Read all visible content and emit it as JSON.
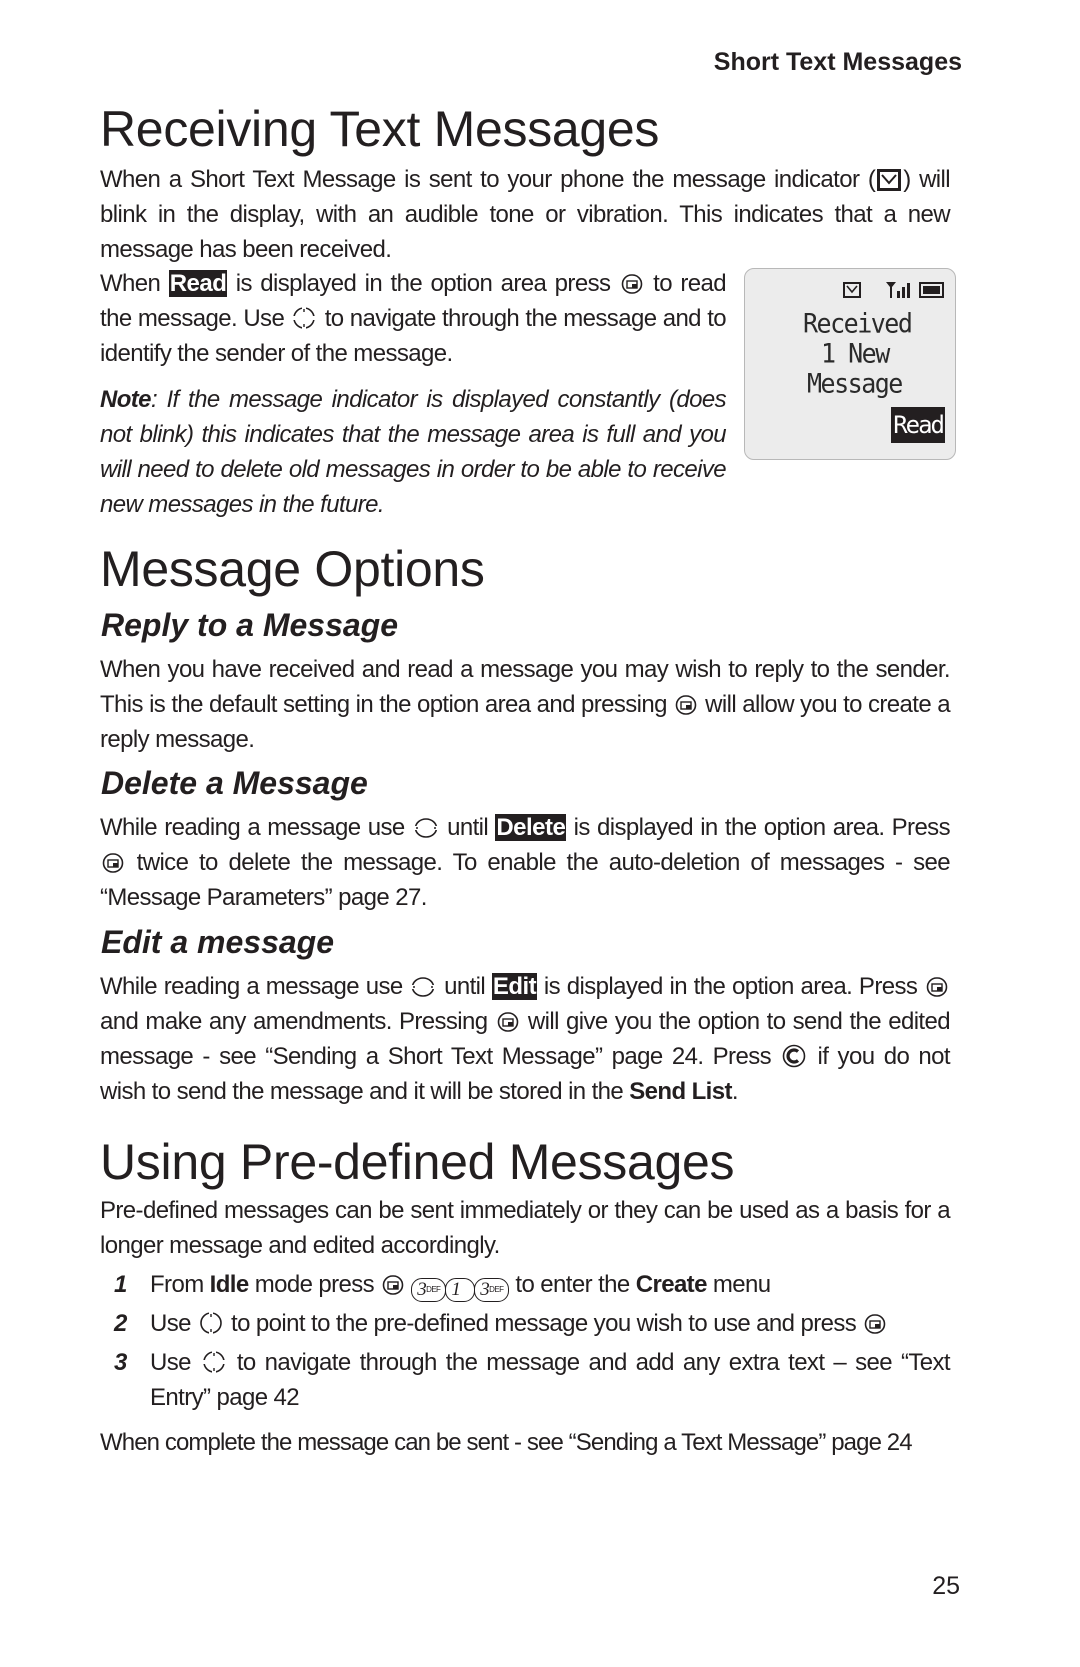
{
  "running_head": "Short Text Messages",
  "page_number": "25",
  "sections": {
    "receiving": {
      "title": "Receiving Text Messages",
      "p1_a": "When a Short Text Message is sent to your phone the message indicator (",
      "p1_b": ") will blink in the display, with an audible tone or vibration. This indicates that a new message has been received.",
      "p2_a": "When ",
      "p2_read": "Read",
      "p2_b": " is displayed in the option area press ",
      "p2_c": " to read the message. Use ",
      "p2_d": " to navigate through the message and to identify the sender of the message.",
      "note_label": "Note",
      "note_text": ": If the message indicator is displayed constantly (does not blink) this indicates that the message area is full and you will need to delete old messages in order to be able to receive new messages in the future."
    },
    "phone_display": {
      "line1": "Received",
      "line2": "1 New",
      "line3": "Message",
      "softkey": "Read",
      "icons": [
        "envelope-icon",
        "signal-icon",
        "battery-icon"
      ]
    },
    "options": {
      "title": "Message Options",
      "reply": {
        "heading": "Reply to a Message",
        "text_a": "When you have received and read a message you may wish to reply to the sender. This is the default setting in the option area and pressing ",
        "text_b": " will allow you to create a reply message."
      },
      "delete": {
        "heading": "Delete a Message",
        "text_a": "While reading a message use ",
        "text_b": " until ",
        "label": "Delete",
        "text_c": " is displayed in the option area. Press ",
        "text_d": " twice to delete the message. To enable the auto-deletion of messages - see “Message Parameters” page 27."
      },
      "edit": {
        "heading": "Edit a message",
        "text_a": "While reading a message use ",
        "text_b": " until ",
        "label": "Edit",
        "text_c": " is displayed in the option area. Press ",
        "text_d": " and make any amendments. Pressing ",
        "text_e": " will give you the option to send the edited message - see “Sending a Short Text Message” page 24. Press ",
        "text_f": " if you do not wish to send the message and it will be stored in the ",
        "bold": "Send List",
        "text_g": "."
      }
    },
    "predefined": {
      "title": "Using Pre-defined Messages",
      "intro": "Pre-defined messages can be sent immediately or they can be used as a basis for a longer message and edited accordingly.",
      "steps": [
        {
          "num": "1",
          "a": "From ",
          "bold1": "Idle",
          "b": " mode press ",
          "keys": [
            "3",
            "1",
            "3"
          ],
          "key_sub": "DEF",
          "c": " to enter the ",
          "bold2": "Create",
          "d": " menu"
        },
        {
          "num": "2",
          "a": "Use ",
          "b": " to point to the pre-defined message you wish to use and press "
        },
        {
          "num": "3",
          "a": "Use ",
          "b": " to navigate through the message and add any extra text – see “Text Entry” page 42"
        }
      ],
      "closing": "When complete the message can be sent - see “Sending a Text Message” page 24"
    }
  }
}
